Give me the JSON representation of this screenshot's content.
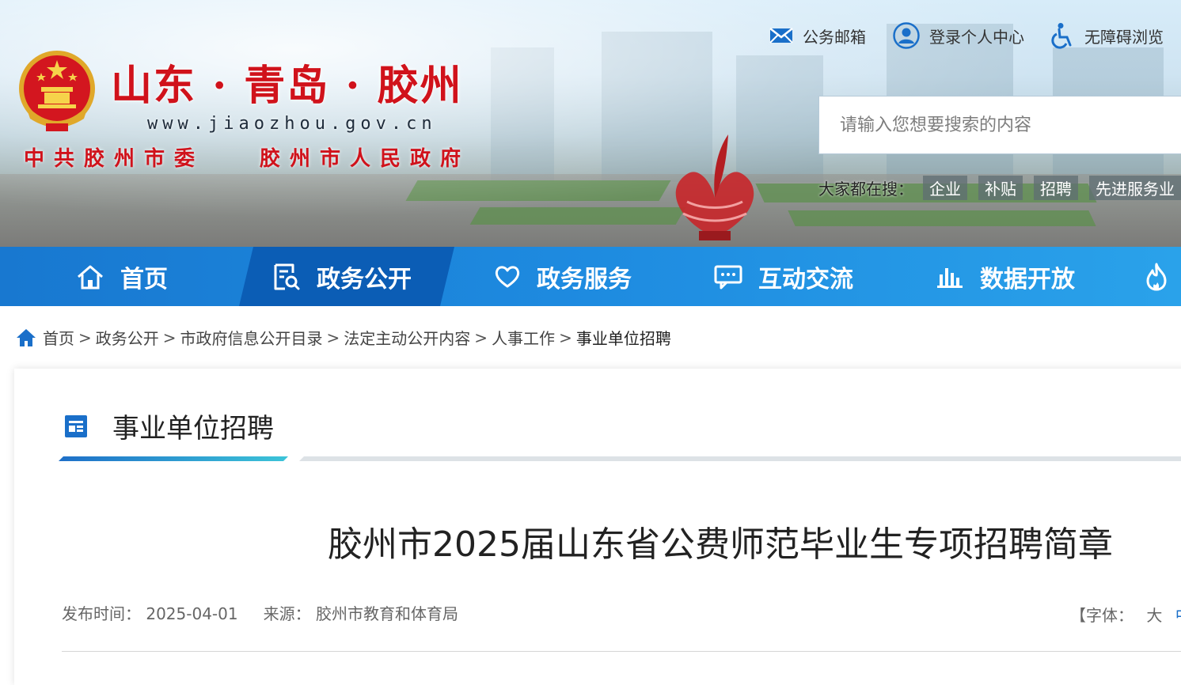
{
  "header": {
    "logo_title": "山东 · 青岛 · 胶州",
    "logo_url": "www.jiaozhou.gov.cn",
    "logo_party": "中共胶州市委",
    "logo_gov": "胶州市人民政府",
    "top_links": [
      {
        "label": "公务邮箱",
        "icon": "mail-icon"
      },
      {
        "label": "登录个人中心",
        "icon": "user-icon"
      },
      {
        "label": "无障碍浏览",
        "icon": "accessibility-icon"
      }
    ],
    "search_placeholder": "请输入您想要搜索的内容",
    "hot_label": "大家都在搜：",
    "hot_tags": [
      "企业",
      "补贴",
      "招聘",
      "先进服务业"
    ]
  },
  "nav": {
    "items": [
      {
        "label": "首页",
        "icon": "home-icon"
      },
      {
        "label": "政务公开",
        "icon": "document-search-icon",
        "active": true
      },
      {
        "label": "政务服务",
        "icon": "heart-icon"
      },
      {
        "label": "互动交流",
        "icon": "chat-icon"
      },
      {
        "label": "数据开放",
        "icon": "bar-chart-icon"
      },
      {
        "label": "",
        "icon": "flame-icon"
      }
    ]
  },
  "breadcrumb": {
    "items": [
      "首页",
      "政务公开",
      "市政府信息公开目录",
      "法定主动公开内容",
      "人事工作",
      "事业单位招聘"
    ],
    "separator": ">"
  },
  "section": {
    "title": "事业单位招聘"
  },
  "article": {
    "title": "胶州市2025届山东省公费师范毕业生专项招聘简章",
    "publish_label": "发布时间：",
    "publish_date": "2025-04-01",
    "source_label": "来源：",
    "source": "胶州市教育和体育局",
    "font_label": "【字体：",
    "font_options": [
      "大",
      "中"
    ]
  },
  "colors": {
    "brand_red": "#d0121b",
    "nav_blue": "#1e8be0",
    "nav_active": "#0b5db5",
    "link_blue": "#1a6fc9"
  }
}
